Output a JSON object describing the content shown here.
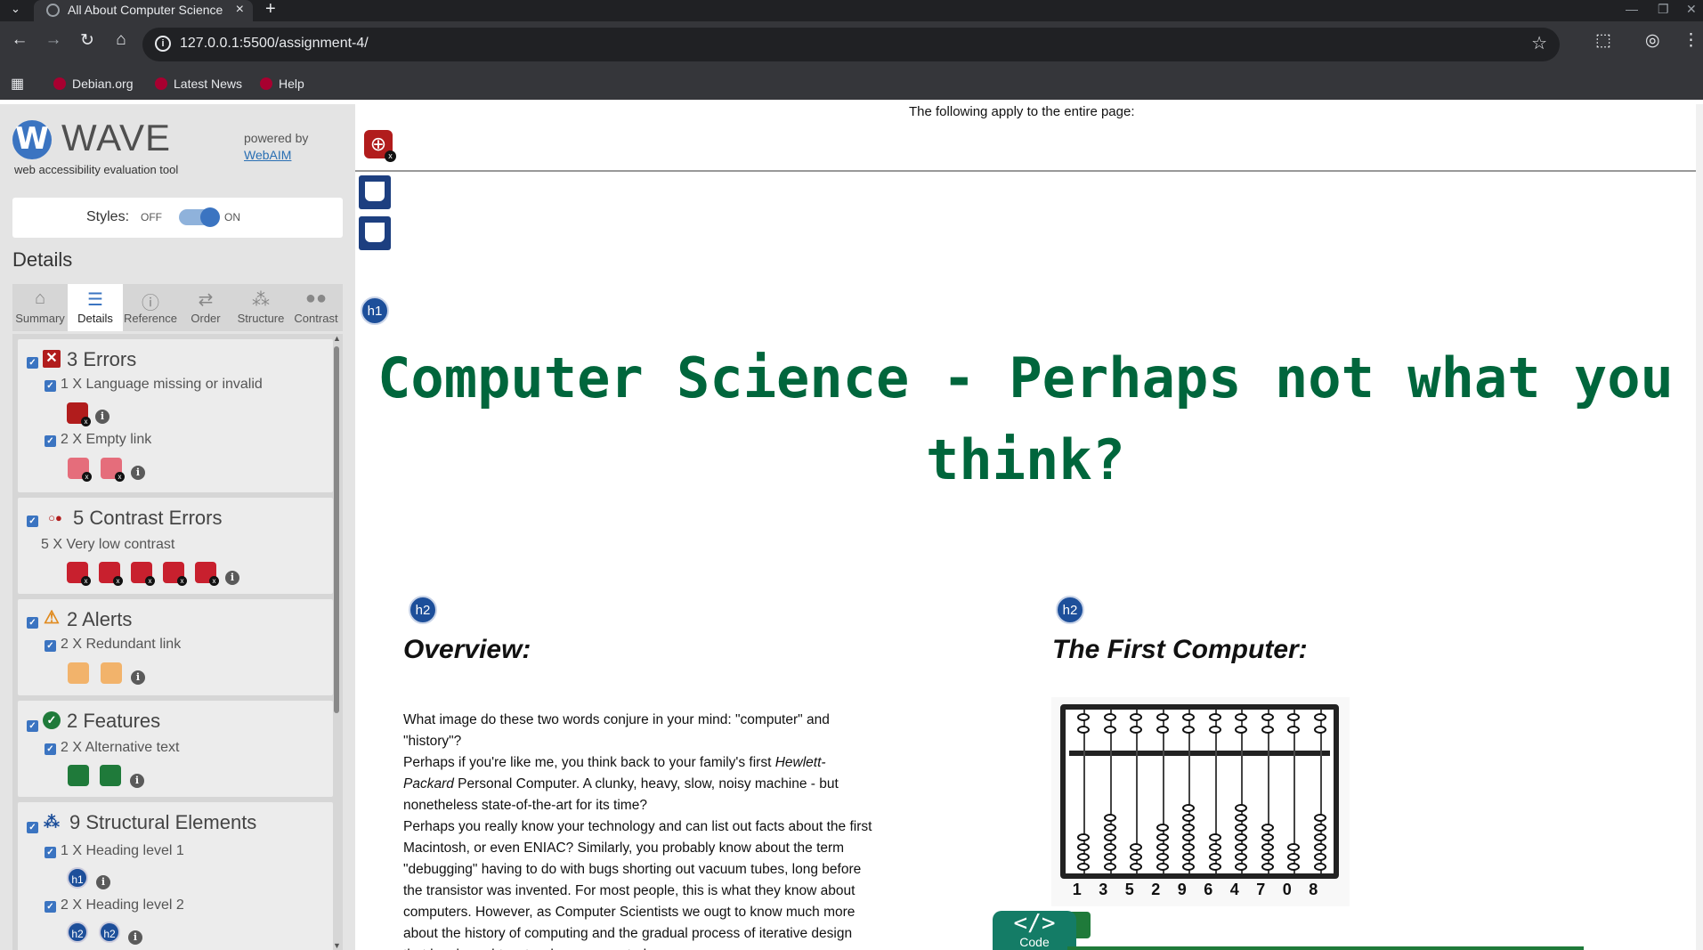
{
  "browser": {
    "tab_title": "All About Computer Science",
    "tab_close": "×",
    "new_tab": "+",
    "url": "127.0.0.1:5500/assignment-4/",
    "bookmarks": [
      "Debian.org",
      "Latest News",
      "Help"
    ]
  },
  "wave": {
    "logo_letter": "W",
    "logo_text": "WAVE",
    "logo_sub": "web accessibility evaluation tool",
    "powered_by": "powered by",
    "webaim": "WebAIM",
    "styles_label": "Styles:",
    "styles_off": "OFF",
    "styles_on": "ON",
    "styles_enabled": true,
    "details_heading": "Details",
    "tabs": [
      {
        "label": "Summary",
        "icon": "home-icon"
      },
      {
        "label": "Details",
        "icon": "list-icon"
      },
      {
        "label": "Reference",
        "icon": "info-icon"
      },
      {
        "label": "Order",
        "icon": "order-icon"
      },
      {
        "label": "Structure",
        "icon": "structure-icon"
      },
      {
        "label": "Contrast",
        "icon": "contrast-icon"
      }
    ],
    "active_tab": "Details",
    "categories": {
      "errors": {
        "title": "3 Errors",
        "items": [
          "1 X Language missing or invalid",
          "2 X Empty link"
        ]
      },
      "contrast": {
        "title": "5 Contrast Errors",
        "items": [
          "5 X Very low contrast"
        ]
      },
      "alerts": {
        "title": "2 Alerts",
        "items": [
          "2 X Redundant link"
        ]
      },
      "features": {
        "title": "2 Features",
        "items": [
          "2 X Alternative text"
        ]
      },
      "structure": {
        "title": "9 Structural Elements",
        "items": [
          "1 X Heading level 1",
          "2 X Heading level 2"
        ]
      }
    },
    "colors": {
      "error": "#b11c1c",
      "alert": "#e08a1e",
      "feature": "#1f7a3a",
      "structure": "#1d4f9a",
      "accent": "#3b74c1"
    }
  },
  "page": {
    "applies_text": "The following apply to the entire page:",
    "h1_badge": "h1",
    "h2_badge": "h2",
    "h1_line1": "Computer Science - Perhaps not what you",
    "h1_line2": "think?",
    "overview_heading": "Overview:",
    "first_computer_heading": "The First Computer:",
    "para": {
      "p1": "What image do these two words conjure in your mind: \"computer\" and \"history\"?",
      "p2_start": "Perhaps if you're like me, you think back to your family's first ",
      "p2_em": "Hewlett-Packard",
      "p2_end": " Personal Computer. A clunky, heavy, slow, noisy machine - but nonetheless state-of-the-art for its time?",
      "p3": "Perhaps you really know your technology and can list out facts about the first Macintosh, or even ENIAC? Similarly, you probably know about the term \"debugging\" having to do with bugs shorting out vacuum tubes, long before the transistor was invented. For most people, this is what they know about computers. However, as Computer Scientists we ougt to know much more about the history of computing and the gradual process of iterative design that has brought us to where we are today."
    },
    "abacus_digits": [
      "1",
      "3",
      "5",
      "2",
      "9",
      "6",
      "4",
      "7",
      "0",
      "8"
    ],
    "code_badge_symbol": "</>",
    "code_badge_label": "Code"
  }
}
